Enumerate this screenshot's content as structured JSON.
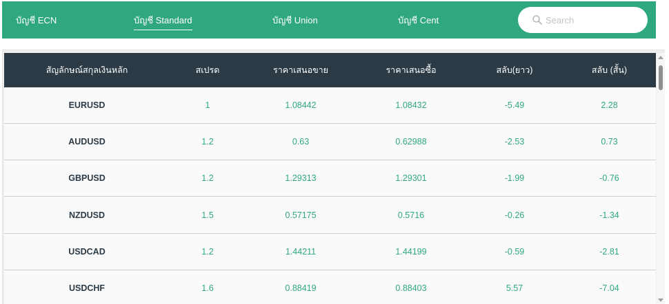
{
  "tabs": [
    {
      "label": "บัญชี ECN",
      "active": false
    },
    {
      "label": "บัญชี Standard",
      "active": true
    },
    {
      "label": "บัญชี Union",
      "active": false
    },
    {
      "label": "บัญชี Cent",
      "active": false
    }
  ],
  "search": {
    "placeholder": "Search",
    "value": "",
    "icon": "search-icon"
  },
  "colors": {
    "header_bar": "#2fa880",
    "table_header": "#2b3a45",
    "value_text": "#2fa880",
    "symbol_text": "#2b3a45"
  },
  "table": {
    "headers": [
      "สัญลักษณ์สกุลเงินหลัก",
      "สเปรด",
      "ราคาเสนอขาย",
      "ราคาเสนอซื้อ",
      "สลับ(ยาว)",
      "สลับ (สั้น)"
    ],
    "rows": [
      [
        "EURUSD",
        "1",
        "1.08442",
        "1.08432",
        "-5.49",
        "2.28"
      ],
      [
        "AUDUSD",
        "1.2",
        "0.63",
        "0.62988",
        "-2.53",
        "0.73"
      ],
      [
        "GBPUSD",
        "1.2",
        "1.29313",
        "1.29301",
        "-1.99",
        "-0.76"
      ],
      [
        "NZDUSD",
        "1.5",
        "0.57175",
        "0.5716",
        "-0.26",
        "-1.34"
      ],
      [
        "USDCAD",
        "1.2",
        "1.44211",
        "1.44199",
        "-0.59",
        "-2.81"
      ],
      [
        "USDCHF",
        "1.6",
        "0.88419",
        "0.88403",
        "5.57",
        "-7.04"
      ]
    ]
  }
}
